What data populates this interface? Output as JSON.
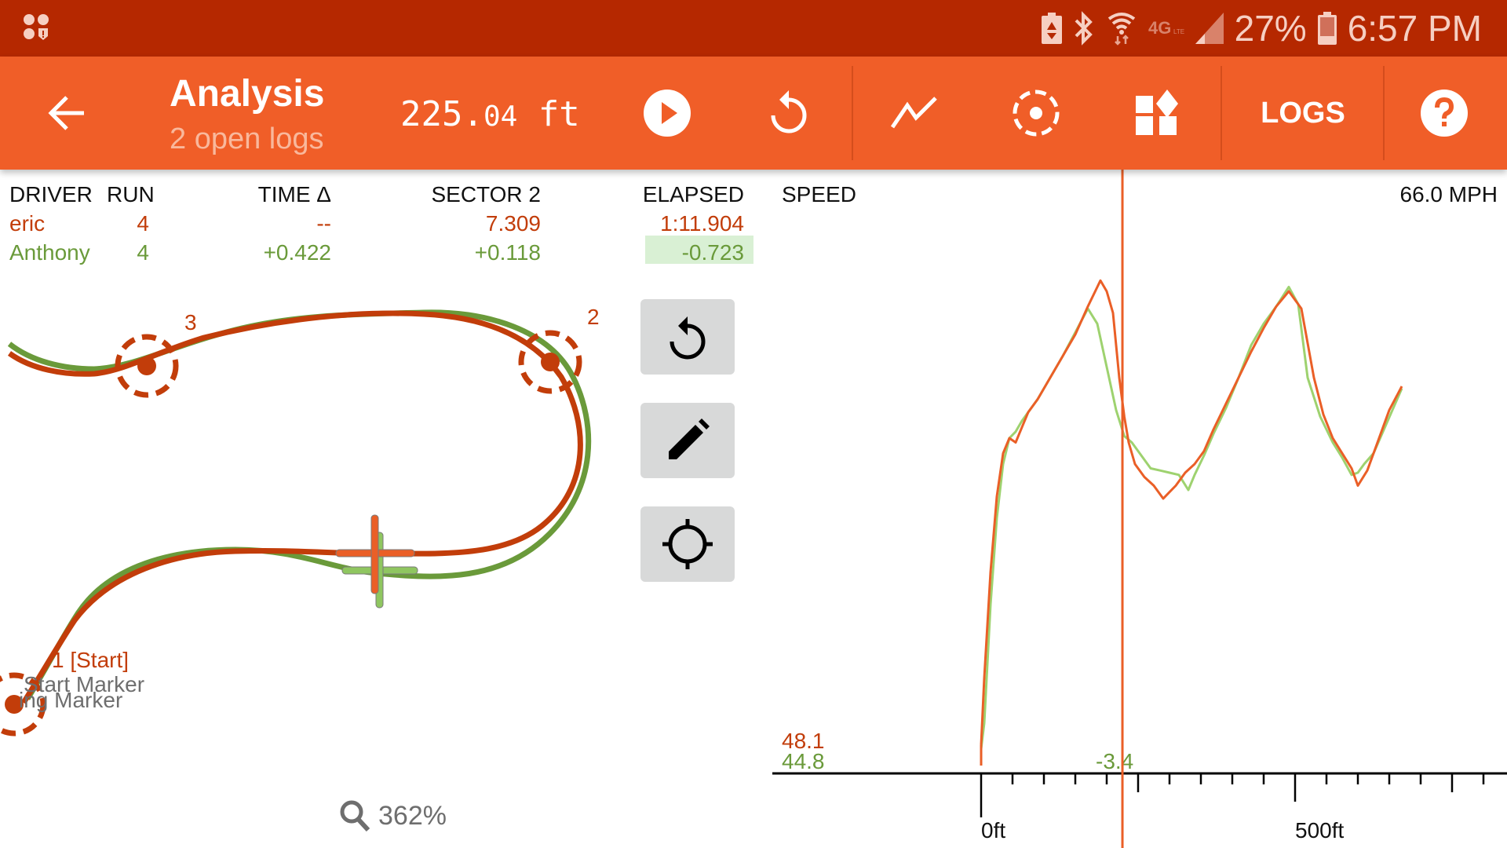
{
  "status_bar": {
    "battery_percent": "27%",
    "time": "6:57 PM",
    "network": "4G LTE",
    "icons": [
      "app-notification-icon",
      "battery-saver-icon",
      "bluetooth-icon",
      "wifi-icon",
      "lte-icon",
      "signal-icon",
      "battery-icon"
    ]
  },
  "toolbar": {
    "back_icon": "arrow-left-icon",
    "title": "Analysis",
    "subtitle": "2 open logs",
    "distance_main": "225.",
    "distance_decimal": "04",
    "distance_unit": " ft",
    "play_icon": "play-circle-icon",
    "reset_icon": "replay-icon",
    "chart_icon": "line-chart-icon",
    "marker_icon": "dashed-target-icon",
    "widgets_icon": "widgets-icon",
    "logs_label": "LOGS",
    "help_icon": "help-circle-icon"
  },
  "colors": {
    "status_bar": "#b52800",
    "toolbar": "#f05e28",
    "driver1": "#c23d0a",
    "driver1_chart": "#ea5f27",
    "driver2": "#6a9a3a",
    "driver2_chart": "#9ed26f",
    "highlight_bg": "#d9f0d4"
  },
  "table": {
    "headers": [
      "DRIVER",
      "RUN",
      "TIME Δ",
      "SECTOR 2",
      "ELAPSED"
    ],
    "rows": [
      {
        "driver": "eric",
        "run": "4",
        "time_delta": "--",
        "sector": "7.309",
        "elapsed": "1:11.904",
        "color": "driver1"
      },
      {
        "driver": "Anthony",
        "run": "4",
        "time_delta": "+0.422",
        "sector": "+0.118",
        "elapsed": "-0.723",
        "color": "driver2",
        "elapsed_highlight": true
      }
    ]
  },
  "map": {
    "markers": [
      {
        "label": "1 [Start]",
        "sublabels": [
          "Start Marker",
          "ing Marker"
        ]
      },
      {
        "label": "2"
      },
      {
        "label": "3"
      }
    ],
    "zoom_label": "362%",
    "side_buttons": [
      "replay-icon",
      "edit-pencil-icon",
      "gps-crosshair-icon"
    ]
  },
  "chart_data": {
    "type": "line",
    "title": "SPEED",
    "current_value_label": "66.0 MPH",
    "x_unit": "ft",
    "x_tick_labels": [
      "0ft",
      "500ft"
    ],
    "x_range_ft": [
      -325,
      500
    ],
    "cursor_ft": 225.04,
    "y_unit": "MPH",
    "y_range": [
      44,
      68
    ],
    "start_values": {
      "eric": "48.1",
      "Anthony": "44.8"
    },
    "cursor_delta_label": "-3.4",
    "grid": false,
    "series": [
      {
        "name": "eric",
        "color": "#ea5f27",
        "x": [
          0,
          5,
          15,
          25,
          35,
          45,
          55,
          65,
          75,
          90,
          110,
          130,
          150,
          170,
          190,
          200,
          210,
          220,
          228,
          235,
          245,
          260,
          275,
          290,
          300,
          310,
          325,
          340,
          355,
          370,
          390,
          410,
          430,
          450,
          470,
          490,
          510,
          530,
          545,
          560,
          575,
          590,
          600,
          615,
          630,
          650,
          670
        ],
        "y": [
          45.0,
          48.1,
          53.0,
          56.5,
          58.5,
          59.2,
          59.0,
          59.7,
          60.4,
          61.0,
          62.0,
          63.0,
          64.0,
          65.3,
          66.5,
          66.0,
          65.0,
          62.0,
          60.2,
          59.0,
          58.0,
          57.4,
          57.0,
          56.4,
          56.7,
          57.0,
          57.6,
          58.0,
          58.6,
          59.6,
          60.8,
          62.0,
          63.2,
          64.3,
          65.3,
          66.0,
          65.2,
          62.0,
          60.3,
          59.2,
          58.5,
          57.8,
          57.0,
          57.7,
          58.9,
          60.5,
          61.6
        ]
      },
      {
        "name": "Anthony",
        "color": "#9ed26f",
        "x": [
          0,
          5,
          15,
          25,
          35,
          45,
          55,
          65,
          75,
          90,
          110,
          130,
          150,
          170,
          185,
          200,
          215,
          228,
          240,
          255,
          270,
          285,
          300,
          315,
          330,
          340,
          355,
          370,
          390,
          410,
          430,
          450,
          470,
          490,
          505,
          520,
          540,
          560,
          575,
          590,
          600,
          610,
          625,
          640,
          655,
          670
        ],
        "y": [
          44.8,
          46.0,
          51.5,
          55.5,
          58.0,
          59.2,
          59.5,
          60.0,
          60.4,
          61.0,
          62.0,
          63.0,
          64.1,
          65.2,
          64.5,
          62.5,
          60.5,
          59.3,
          59.0,
          58.4,
          57.8,
          57.7,
          57.6,
          57.5,
          56.8,
          57.5,
          58.4,
          59.4,
          60.6,
          62.0,
          63.5,
          64.5,
          65.3,
          66.2,
          65.4,
          62.0,
          60.2,
          59.0,
          58.3,
          57.5,
          57.6,
          58.0,
          58.5,
          59.5,
          60.5,
          61.5
        ]
      }
    ]
  }
}
